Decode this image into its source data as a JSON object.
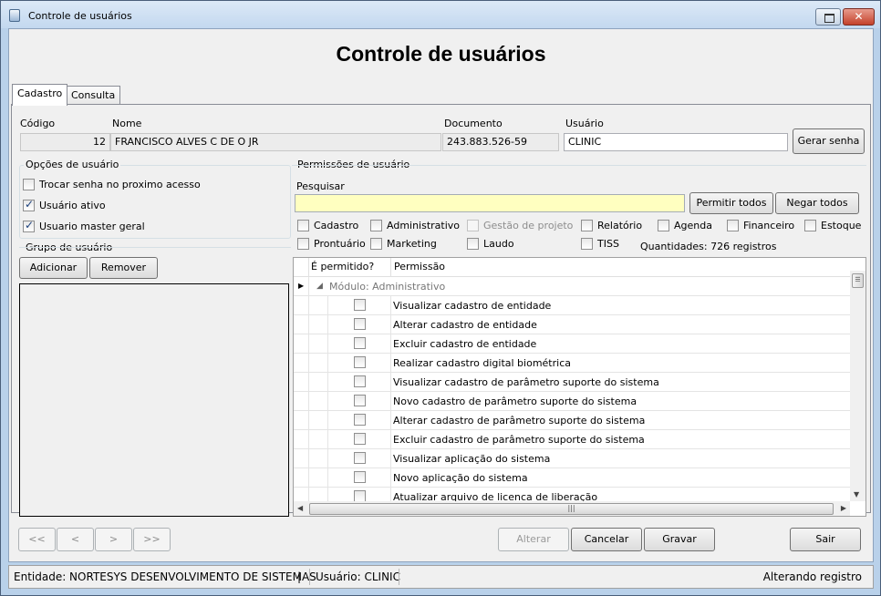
{
  "window": {
    "title": "Controle de usuários",
    "close_glyph": "✕"
  },
  "page_title": "Controle de usuários",
  "tabs": [
    {
      "label": "Cadastro"
    },
    {
      "label": "Consulta"
    }
  ],
  "fields": {
    "codigo": {
      "label": "Código",
      "value": "12"
    },
    "nome": {
      "label": "Nome",
      "value": "FRANCISCO ALVES C DE O JR"
    },
    "documento": {
      "label": "Documento",
      "value": "243.883.526-59"
    },
    "usuario": {
      "label": "Usuário",
      "value": "CLINIC"
    }
  },
  "buttons": {
    "gerar_senha": "Gerar senha",
    "adicionar": "Adicionar",
    "remover": "Remover",
    "permitir_todos": "Permitir todos",
    "negar_todos": "Negar todos",
    "alterar": "Alterar",
    "cancelar": "Cancelar",
    "gravar": "Gravar",
    "sair": "Sair"
  },
  "user_options": {
    "title": "Opções de usuário",
    "items": [
      {
        "label": "Trocar senha no proximo acesso",
        "checked": false
      },
      {
        "label": "Usuário ativo",
        "checked": true
      },
      {
        "label": "Usuario master geral",
        "checked": true
      }
    ]
  },
  "user_group": {
    "title": "Grupo de usuário"
  },
  "permissions": {
    "title": "Permissões de usuário",
    "search_label": "Pesquisar",
    "search_value": "",
    "modules": [
      {
        "label": "Cadastro",
        "checked": false,
        "disabled": false
      },
      {
        "label": "Administrativo",
        "checked": false,
        "disabled": false
      },
      {
        "label": "Gestão de projeto",
        "checked": false,
        "disabled": true
      },
      {
        "label": "Relatório",
        "checked": false,
        "disabled": false
      },
      {
        "label": "Agenda",
        "checked": false,
        "disabled": false
      },
      {
        "label": "Financeiro",
        "checked": false,
        "disabled": false
      },
      {
        "label": "Estoque",
        "checked": false,
        "disabled": false
      },
      {
        "label": "Prontuário",
        "checked": false,
        "disabled": false
      },
      {
        "label": "Marketing",
        "checked": false,
        "disabled": false
      },
      {
        "label": "Laudo",
        "checked": false,
        "disabled": false
      },
      {
        "label": "TISS",
        "checked": false,
        "disabled": false
      }
    ],
    "quantity_text": "Quantidades: 726 registros",
    "grid": {
      "columns": [
        "É permitido?",
        "Permissão"
      ],
      "group_row": "Módulo: Administrativo",
      "rows": [
        "Visualizar cadastro de entidade",
        "Alterar cadastro de entidade",
        "Excluir cadastro de entidade",
        "Realizar cadastro digital biométrica",
        "Visualizar cadastro de parâmetro suporte do sistema",
        "Novo cadastro de parâmetro suporte do sistema",
        "Alterar cadastro de parâmetro suporte do sistema",
        "Excluir cadastro de parâmetro suporte do sistema",
        "Visualizar aplicação do sistema",
        "Novo aplicação do sistema",
        "Atualizar arquivo de licenca de liberação"
      ]
    }
  },
  "nav": [
    "<<",
    "<",
    ">",
    ">>"
  ],
  "status": {
    "entidade": "Entidade: NORTESYS DESENVOLVIMENTO DE SISTEMAS",
    "separator": "|",
    "usuario": "Usuário: CLINIC",
    "state": "Alterando registro"
  }
}
